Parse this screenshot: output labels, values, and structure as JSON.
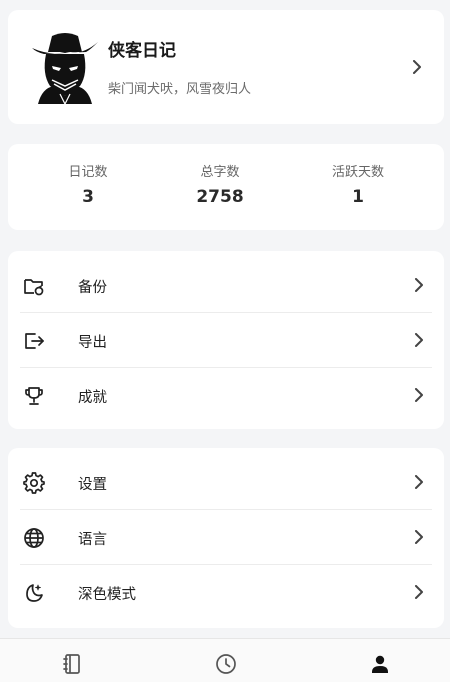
{
  "profile": {
    "name": "侠客日记",
    "motto": "柴门闻犬吠，风雪夜归人",
    "avatar_icon": "masked-cowboy-avatar"
  },
  "stats": [
    {
      "label": "日记数",
      "value": "3"
    },
    {
      "label": "总字数",
      "value": "2758"
    },
    {
      "label": "活跃天数",
      "value": "1"
    }
  ],
  "menu_group_1": [
    {
      "label": "备份",
      "icon": "folder-sync-icon"
    },
    {
      "label": "导出",
      "icon": "export-icon"
    },
    {
      "label": "成就",
      "icon": "trophy-icon"
    }
  ],
  "menu_group_2": [
    {
      "label": "设置",
      "icon": "gear-icon"
    },
    {
      "label": "语言",
      "icon": "globe-icon"
    },
    {
      "label": "深色模式",
      "icon": "moon-stars-icon"
    }
  ],
  "bottom_nav": [
    {
      "name": "diary",
      "icon": "notebook-icon",
      "active": false
    },
    {
      "name": "history",
      "icon": "clock-icon",
      "active": false
    },
    {
      "name": "profile",
      "icon": "person-icon",
      "active": true
    }
  ],
  "colors": {
    "background": "#f4f5f7",
    "card": "#ffffff",
    "text": "#1f1f1f",
    "secondary": "#6b6b6b",
    "active_nav": "#111111",
    "inactive_nav": "#555555"
  }
}
